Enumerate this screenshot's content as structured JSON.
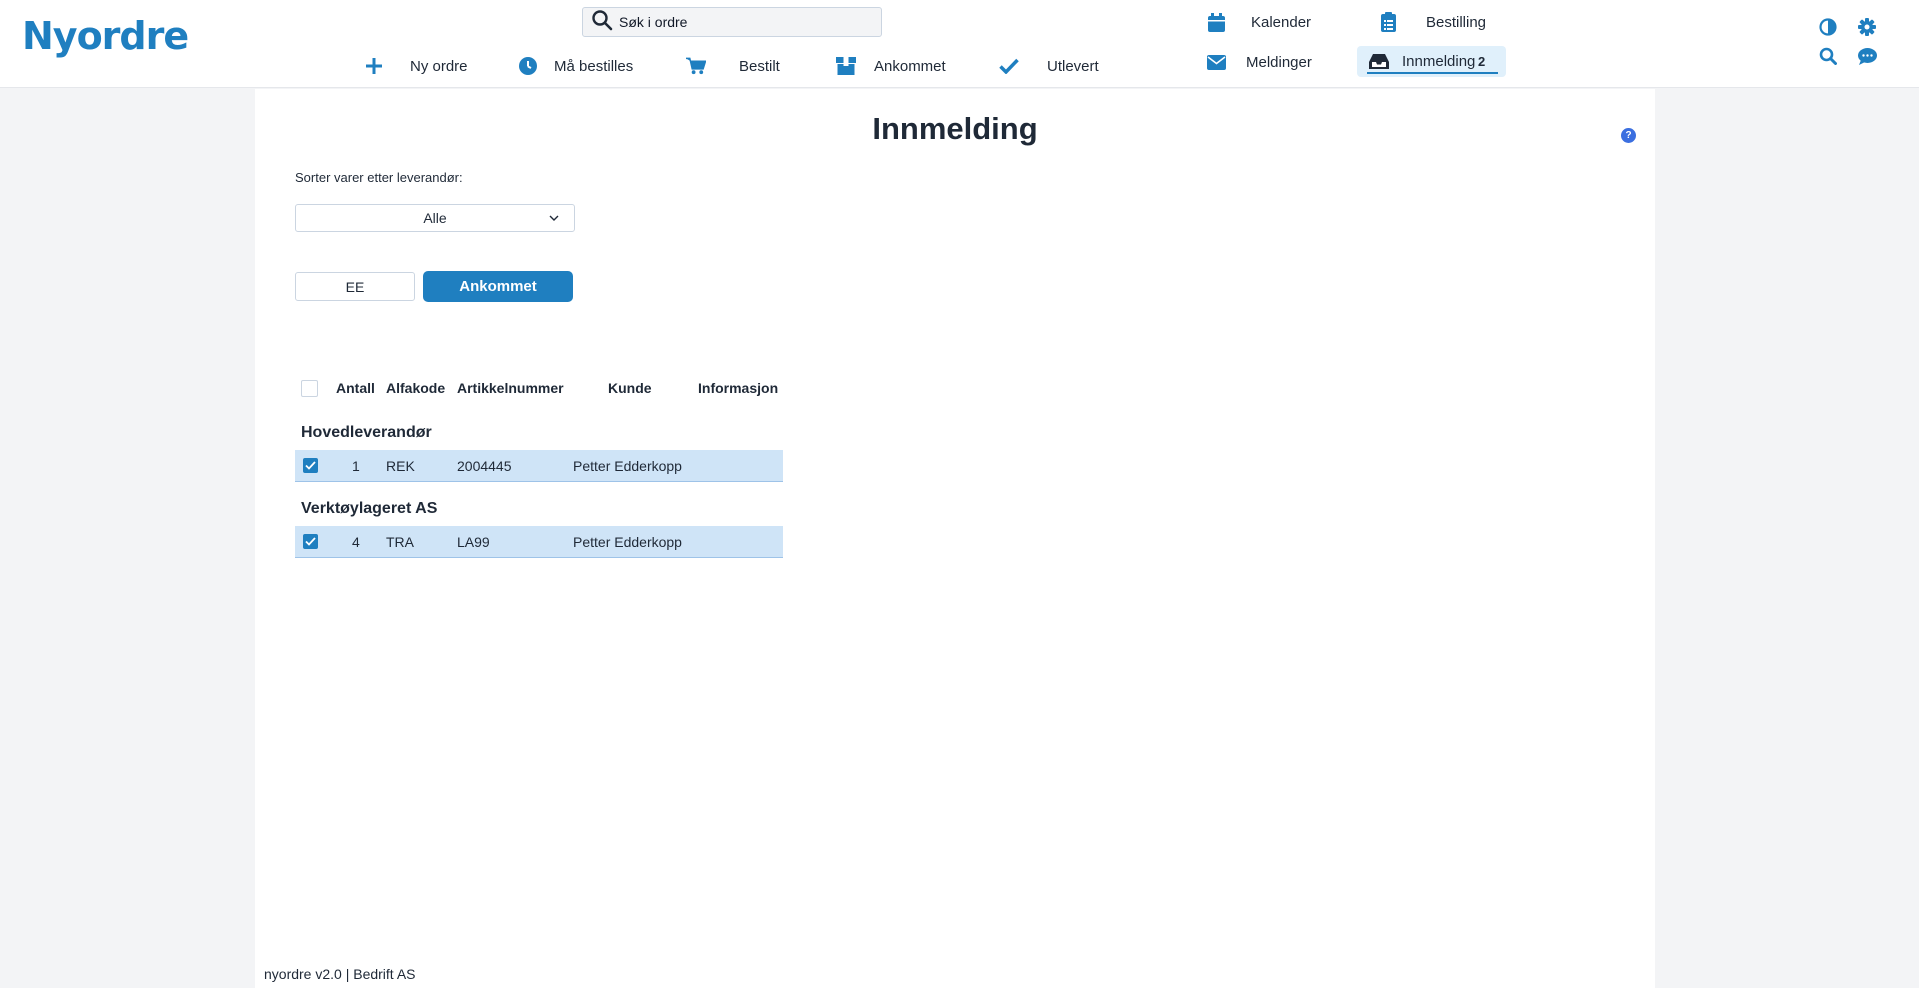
{
  "app": {
    "logo": "Nyordre"
  },
  "search": {
    "placeholder": "Søk i ordre"
  },
  "nav": {
    "new_order": "Ny ordre",
    "must_order": "Må bestilles",
    "ordered": "Bestilt",
    "arrived": "Ankommet",
    "delivered": "Utlevert",
    "calendar": "Kalender",
    "ordering": "Bestilling",
    "messages": "Meldinger",
    "report": "Innmelding",
    "report_count": "2"
  },
  "page": {
    "title": "Innmelding",
    "help": "?",
    "sort_label": "Sorter varer etter leverandør:",
    "sort_value": "Alle",
    "btn_ee": "EE",
    "btn_arrived": "Ankommet"
  },
  "table": {
    "headers": {
      "qty": "Antall",
      "alpha": "Alfakode",
      "article": "Artikkelnummer",
      "customer": "Kunde",
      "info": "Informasjon"
    },
    "groups": [
      {
        "name": "Hovedleverandør",
        "rows": [
          {
            "qty": "1",
            "alpha": "REK",
            "article": "2004445",
            "customer": "Petter Edderkopp",
            "info": ""
          }
        ]
      },
      {
        "name": "Verktøylageret AS",
        "rows": [
          {
            "qty": "4",
            "alpha": "TRA",
            "article": "LA99",
            "customer": "Petter Edderkopp",
            "info": ""
          }
        ]
      }
    ]
  },
  "footer": {
    "text": "nyordre v2.0 | Bedrift AS"
  },
  "colors": {
    "accent": "#1f7fc0",
    "row_selected": "#cfe4f7",
    "help": "#3b6fe0"
  }
}
